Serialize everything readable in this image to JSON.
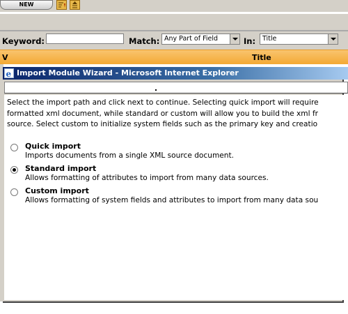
{
  "toolbar": {
    "new_label": "NEW",
    "icons": [
      "edit-icon",
      "sort-icon"
    ]
  },
  "search": {
    "keyword_label": "Keyword:",
    "keyword_value": "",
    "match_label": "Match:",
    "match_value": "Any Part of Field",
    "in_label": "In:",
    "in_value": "Title"
  },
  "table": {
    "columns": [
      "V",
      "Title"
    ]
  },
  "dialog": {
    "title": "Import Module Wizard - Microsoft Internet Explorer",
    "intro_lines": [
      "Select the import path and click next to continue. Selecting quick import will require",
      "formatted xml document, while standard or custom will allow you to build the xml fr",
      "source. Select custom to initialize system fields such as the primary key and creatio"
    ],
    "options": [
      {
        "title": "Quick import",
        "desc": "Imports documents from a single XML source document.",
        "selected": false
      },
      {
        "title": "Standard import",
        "desc": "Allows formatting of attributes to import from many data sources.",
        "selected": true
      },
      {
        "title": "Custom import",
        "desc": "Allows formatting of system fields and attributes to import from many data sou",
        "selected": false
      }
    ]
  },
  "colors": {
    "titlebar_start": "#0a246a",
    "header_orange": "#f3a934",
    "window_gray": "#d4d0c8"
  }
}
